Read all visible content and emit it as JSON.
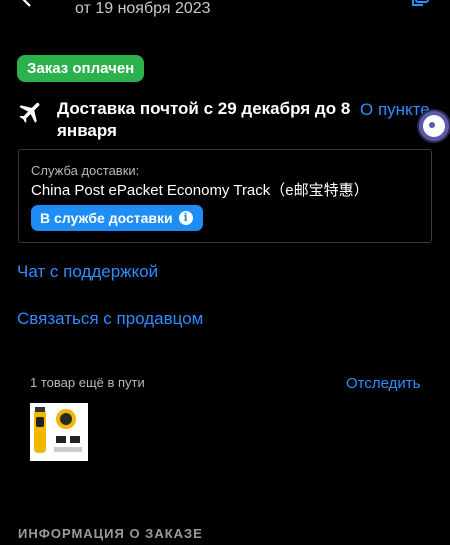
{
  "header": {
    "date_text": "от 19 ноября 2023"
  },
  "status_badge": "Заказ оплачен",
  "delivery": {
    "text": "Доставка почтой с 29 декабря до 8 января",
    "pickup_link": "О пункте"
  },
  "shipping_service": {
    "label": "Служба доставки:",
    "name": "China Post ePacket Economy Track（e邮宝特惠）",
    "button_label": "В службе доставки"
  },
  "links": {
    "chat_support": "Чат с поддержкой",
    "contact_seller": "Связаться с продавцом"
  },
  "shipment": {
    "items_in_transit": "1 товар ещё в пути",
    "track_label": "Отследить"
  },
  "order_info": {
    "heading": "ИНФОРМАЦИЯ О ЗАКАЗЕ"
  },
  "colors": {
    "background": "#000000",
    "accent_blue": "#2f8cff",
    "badge_green": "#2bb24c",
    "button_blue": "#1f8ef4"
  },
  "icons": [
    "back-arrow-icon",
    "copy-icon",
    "airplane-icon",
    "info-icon",
    "assistant-icon"
  ]
}
